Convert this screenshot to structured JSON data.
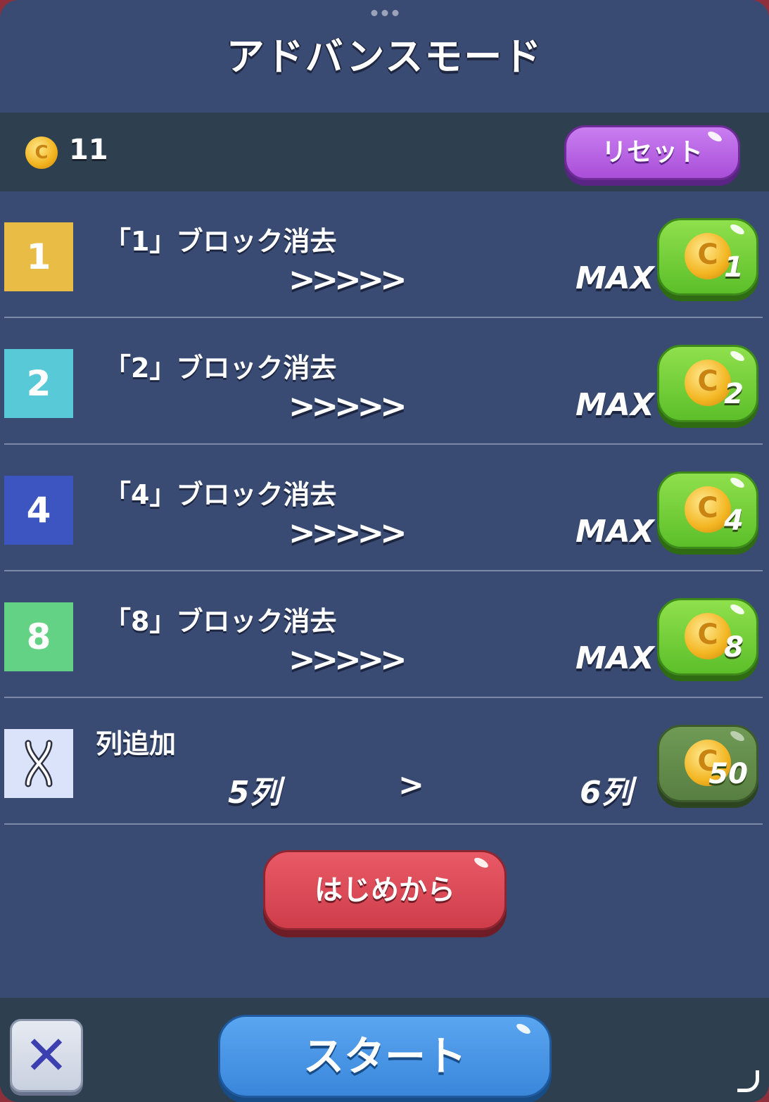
{
  "title": "アドバンスモード",
  "coins": {
    "icon": "coin-icon",
    "count": "11"
  },
  "reset_label": "リセット",
  "upgrades": [
    {
      "tile_label": "1",
      "tile_color": "#e9bd45",
      "label": "「1」ブロック消去",
      "arrows": ">>>>>",
      "max": "MAX",
      "cost": "1"
    },
    {
      "tile_label": "2",
      "tile_color": "#58c9d6",
      "label": "「2」ブロック消去",
      "arrows": ">>>>>",
      "max": "MAX",
      "cost": "2"
    },
    {
      "tile_label": "4",
      "tile_color": "#3c55c0",
      "label": "「4」ブロック消去",
      "arrows": ">>>>>",
      "max": "MAX",
      "cost": "4"
    },
    {
      "tile_label": "8",
      "tile_color": "#63d284",
      "label": "「8」ブロック消去",
      "arrows": ">>>>>",
      "max": "MAX",
      "cost": "8"
    }
  ],
  "column_upgrade": {
    "label": "列追加",
    "from": "5列",
    "separator": ">",
    "to": "6列",
    "cost": "50",
    "tile_color": "#dbe3fb"
  },
  "restart_label": "はじめから",
  "start_label": "スタート",
  "close_label": "✕"
}
